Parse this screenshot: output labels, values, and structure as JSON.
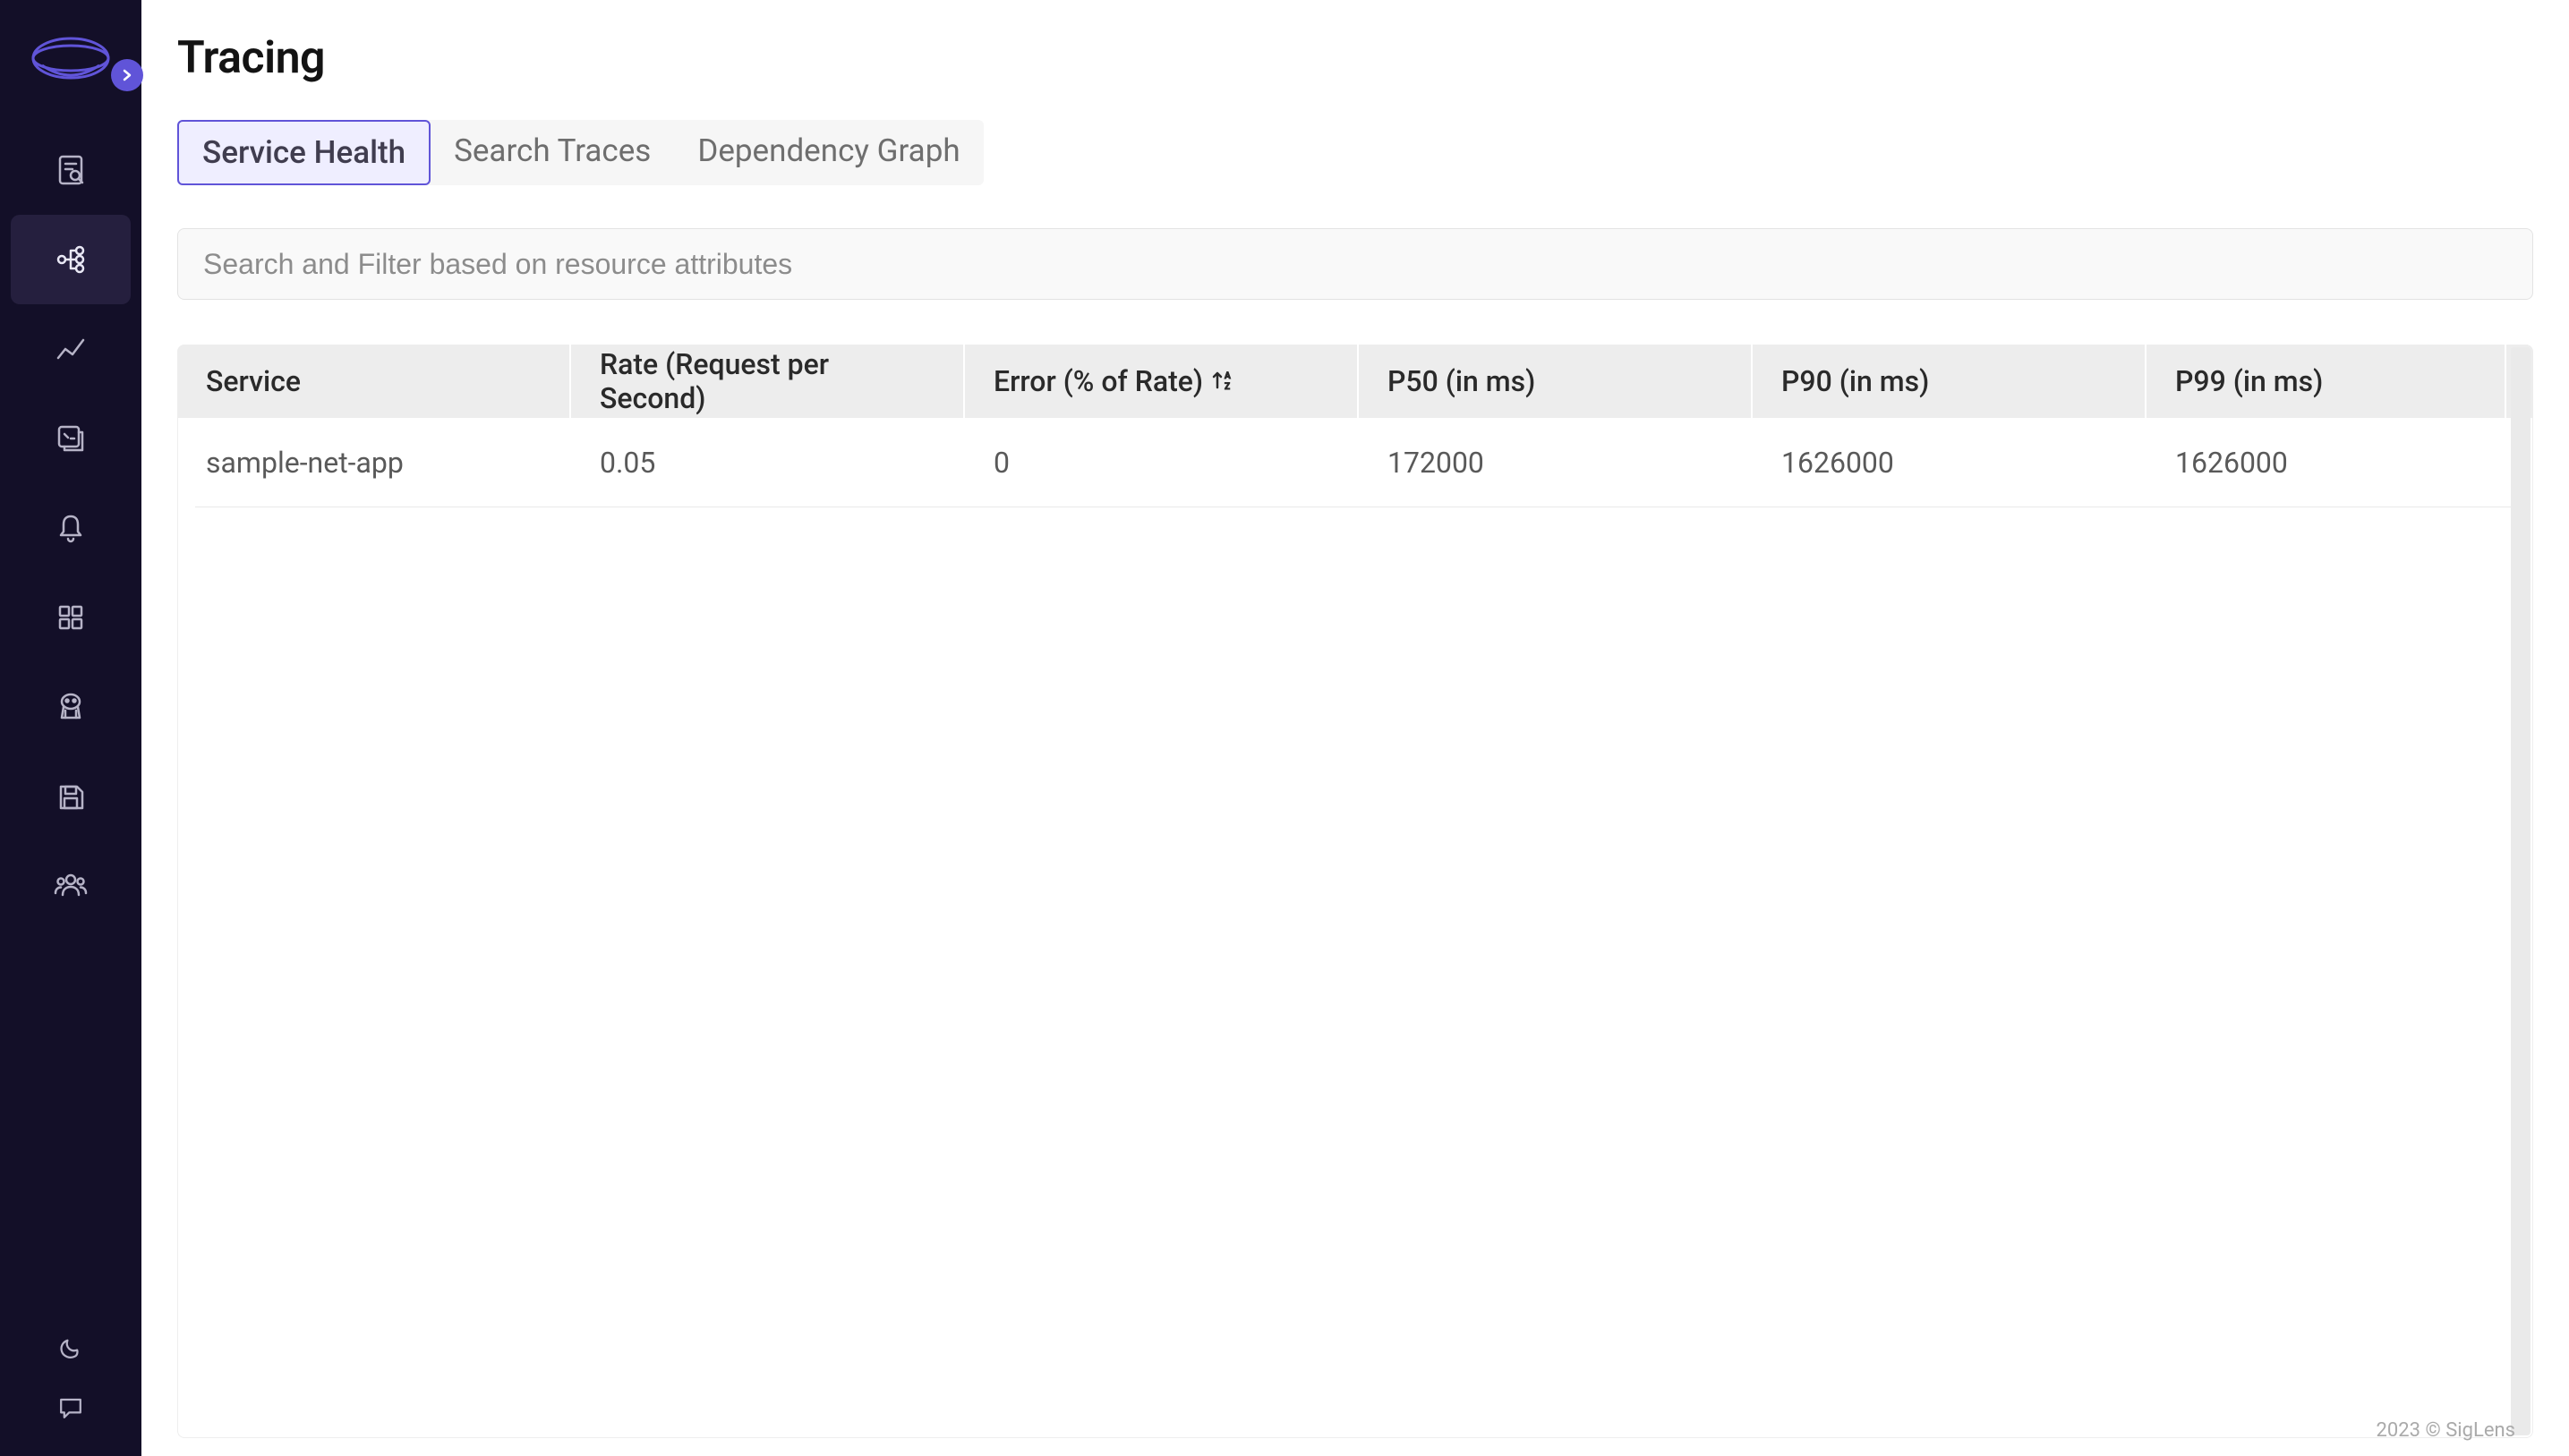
{
  "page": {
    "title": "Tracing"
  },
  "tabs": [
    {
      "label": "Service Health",
      "active": true
    },
    {
      "label": "Search Traces",
      "active": false
    },
    {
      "label": "Dependency Graph",
      "active": false
    }
  ],
  "search": {
    "placeholder": "Search and Filter based on resource attributes",
    "value": ""
  },
  "table": {
    "columns": [
      "Service",
      "Rate (Request per Second)",
      "Error (% of Rate)",
      "P50 (in ms)",
      "P90 (in ms)",
      "P99 (in ms)"
    ],
    "sorted_column_index": 2,
    "rows": [
      {
        "service": "sample-net-app",
        "rate": "0.05",
        "error": "0",
        "p50": "172000",
        "p90": "1626000",
        "p99": "1626000"
      }
    ]
  },
  "sidebar": {
    "items": [
      {
        "name": "search-file-icon"
      },
      {
        "name": "tracing-icon",
        "active": true
      },
      {
        "name": "line-chart-icon"
      },
      {
        "name": "stacks-icon"
      },
      {
        "name": "bell-icon"
      },
      {
        "name": "grid-apps-icon"
      },
      {
        "name": "robot-icon"
      },
      {
        "name": "save-icon"
      },
      {
        "name": "users-icon"
      }
    ],
    "bottom": [
      {
        "name": "moon-icon"
      },
      {
        "name": "chat-icon"
      }
    ]
  },
  "footer": {
    "text": "2023 © SigLens"
  }
}
